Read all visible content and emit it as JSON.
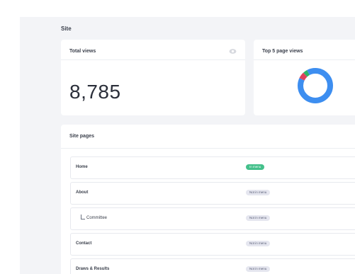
{
  "site": {
    "title": "Site"
  },
  "total_views": {
    "title": "Total views",
    "value": "8,785",
    "icon": "eye-icon"
  },
  "top_pages": {
    "title": "Top 5 page views",
    "chart_data": {
      "type": "pie",
      "style": "donut",
      "slices": [
        {
          "value": 82,
          "color": "#3d8ef0"
        },
        {
          "value": 6,
          "color": "#e0415c"
        },
        {
          "value": 4,
          "color": "#2fb567"
        },
        {
          "value": 8,
          "color": "#3d8ef0"
        }
      ]
    }
  },
  "site_pages": {
    "title": "Site pages",
    "rows": [
      {
        "label": "Home",
        "badge": "In menu",
        "in_menu": true,
        "child": false
      },
      {
        "label": "About",
        "badge": "Not in menu",
        "in_menu": false,
        "child": false
      },
      {
        "label": "Committee",
        "badge": "Not in menu",
        "in_menu": false,
        "child": true
      },
      {
        "label": "Contact",
        "badge": "Not in menu",
        "in_menu": false,
        "child": false
      },
      {
        "label": "Draws & Results",
        "badge": "Not in menu",
        "in_menu": false,
        "child": false
      }
    ]
  },
  "colors": {
    "in_menu": "#44c08b",
    "not_in_menu": "#e5e6ef",
    "background": "#f3f4f7"
  }
}
